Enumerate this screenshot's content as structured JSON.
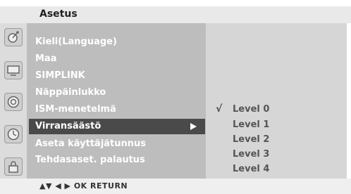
{
  "header": {
    "title": "Asetus"
  },
  "icons": [
    "satellite-dish-icon",
    "monitor-icon",
    "speaker-icon",
    "clock-icon",
    "lock-icon"
  ],
  "menu": {
    "items": [
      {
        "label": "Kieli(Language)"
      },
      {
        "label": "Maa"
      },
      {
        "label": "SIMPLINK"
      },
      {
        "label": "Näppäinlukko"
      },
      {
        "label": "ISM-menetelmä"
      },
      {
        "label": "Virransäästö",
        "selected": true
      },
      {
        "label": "Aseta käyttäjätunnus"
      },
      {
        "label": "Tehdasaset. palautus"
      }
    ]
  },
  "submenu": {
    "check_mark": "√",
    "items": [
      {
        "label": "Level 0",
        "checked": true
      },
      {
        "label": "Level 1"
      },
      {
        "label": "Level 2"
      },
      {
        "label": "Level 3"
      },
      {
        "label": "Level 4"
      }
    ]
  },
  "footer": {
    "hint": "▲▼  ◀ ▶  OK  RETURN"
  }
}
